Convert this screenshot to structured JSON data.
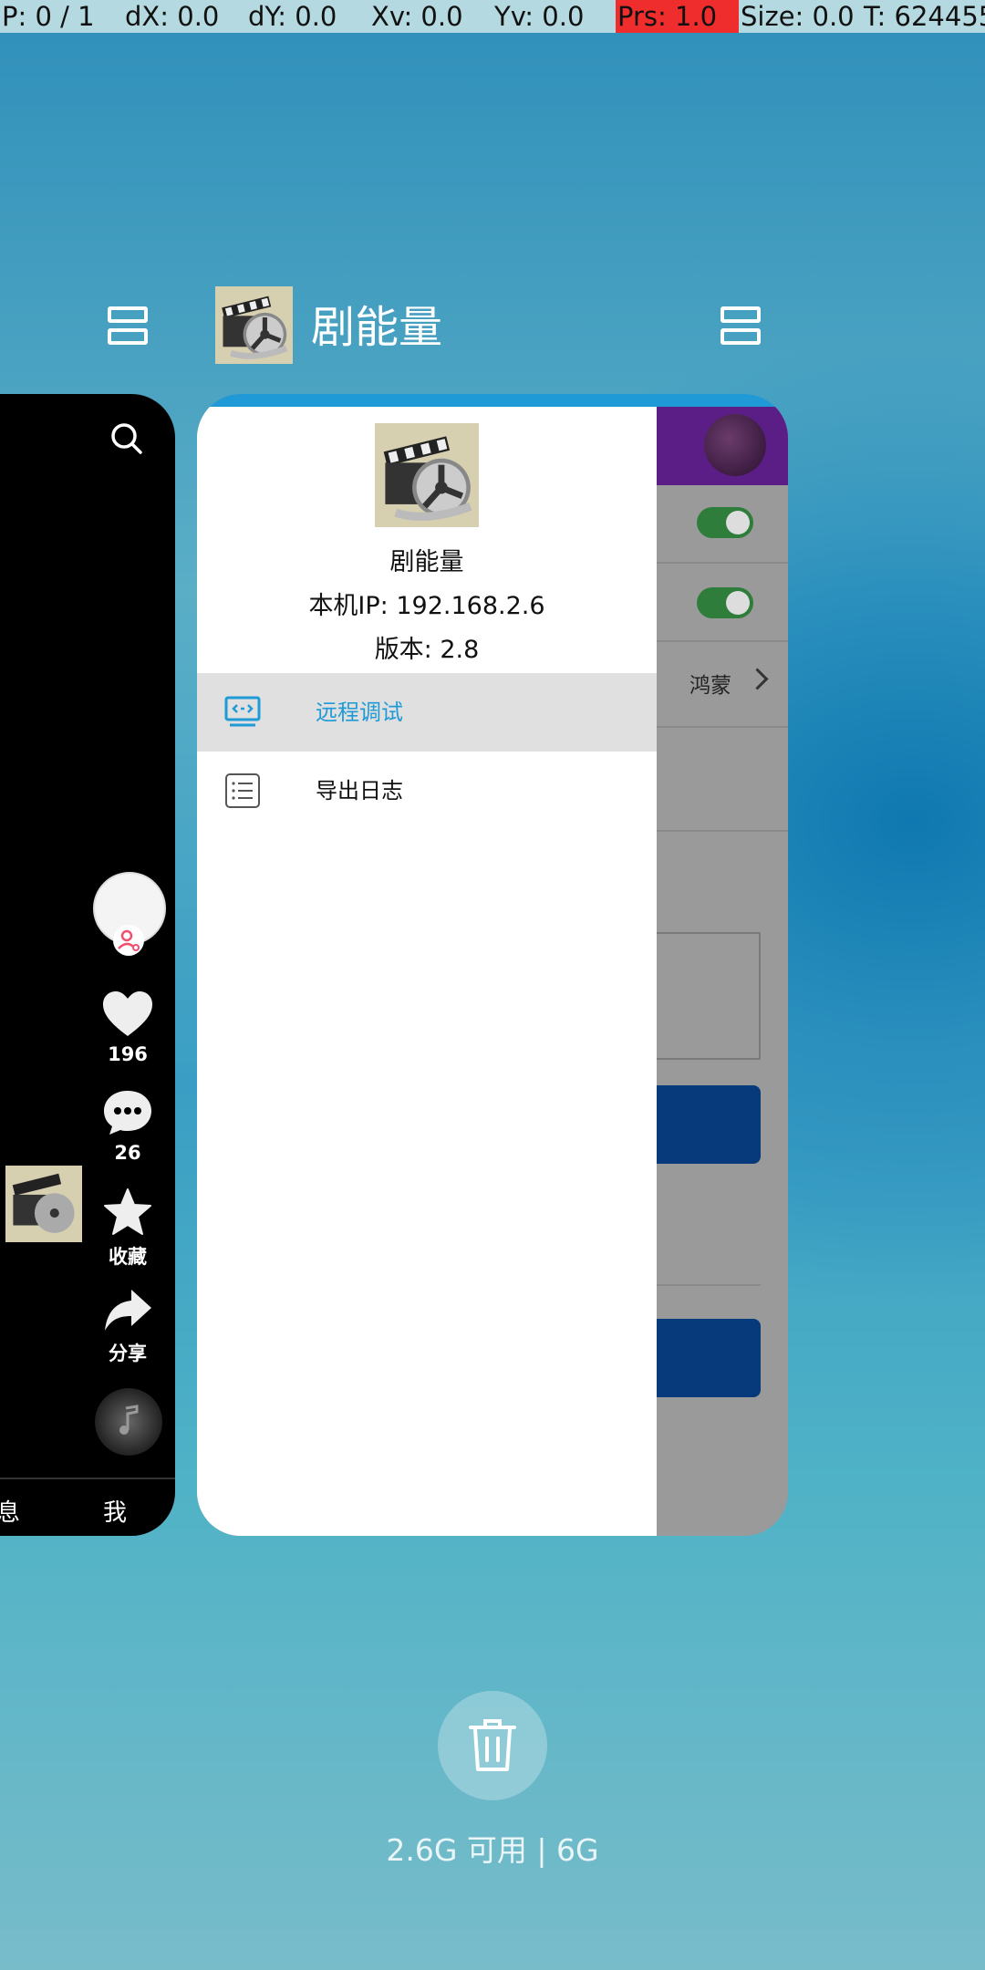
{
  "debug_bar": {
    "cells": [
      {
        "text": "P: 0 / 1",
        "highlight": false
      },
      {
        "text": "dX: 0.0",
        "highlight": false
      },
      {
        "text": "dY: 0.0",
        "highlight": false
      },
      {
        "text": "Xv: 0.0",
        "highlight": false
      },
      {
        "text": "Yv: 0.0",
        "highlight": false
      },
      {
        "text": "Prs: 1.0",
        "highlight": true
      },
      {
        "text": "Size: 0.0",
        "highlight": false
      },
      {
        "text": "T: 624455",
        "highlight": false
      }
    ]
  },
  "recent_task": {
    "app_title": "剧能量",
    "app_icon": "film-reel-icon",
    "split_icon": "split-screen-icon"
  },
  "left_card": {
    "search_icon": "search-icon",
    "like_count": "196",
    "comment_count": "26",
    "favorite_label": "收藏",
    "share_label": "分享",
    "bottom_tabs": {
      "messages_partial": "息",
      "me": "我"
    }
  },
  "main_card": {
    "drawer": {
      "app_name": "剧能量",
      "ip": "本机IP: 192.168.2.6",
      "version": "版本: 2.8",
      "menu": [
        {
          "label": "远程调试",
          "icon": "remote-debug-icon",
          "active": true
        },
        {
          "label": "导出日志",
          "icon": "list-icon",
          "active": false
        }
      ]
    },
    "background": {
      "hongmeng": "鸿蒙"
    }
  },
  "memory": {
    "text": "2.6G 可用 | 6G",
    "clear_icon": "trash-icon"
  },
  "colors": {
    "accent_blue": "#1f9ad6",
    "debug_red": "#f02d2d",
    "debug_bg": "#b4d9e0"
  }
}
